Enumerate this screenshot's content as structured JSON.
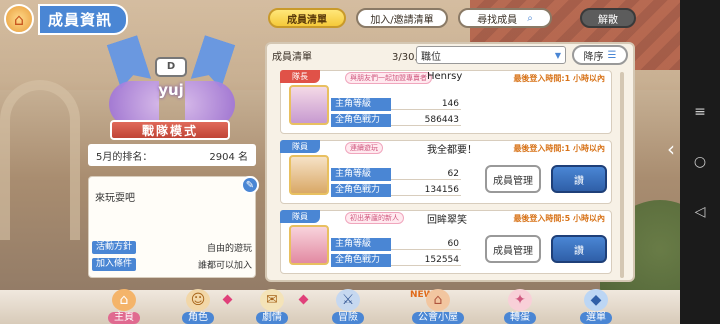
{
  "header": {
    "title": "成員資訊",
    "tabs": [
      {
        "label": "成員清單",
        "active": true
      },
      {
        "label": "加入/邀請清單",
        "active": false
      },
      {
        "label": "尋找成員",
        "active": false
      }
    ],
    "disband_label": "解散"
  },
  "clan": {
    "rank_badge": "D",
    "name": "yuj",
    "mode": "戰隊模式",
    "rank_label": "5月的排名：",
    "rank_value": "2904 名",
    "description": "來玩耍吧",
    "activity_label": "活動方針",
    "activity_value": "自由的遊玩",
    "join_label": "加入條件",
    "join_value": "誰都可以加入"
  },
  "list": {
    "label": "成員清單",
    "count": "3/30人",
    "sort_field": "職位",
    "order_label": "降序",
    "members": [
      {
        "role": "隊長",
        "title": "與朋友們一起加盟專賣者",
        "name": "Henrsy",
        "last_login": "最後登入時間:1 小時以內",
        "level_label": "主角等級",
        "level": "146",
        "power_label": "全角色戰力",
        "power": "586443"
      },
      {
        "role": "隊員",
        "title": "連續遊玩",
        "name": "我全都要！",
        "last_login": "最後登入時間:1 小時以內",
        "level_label": "主角等級",
        "level": "62",
        "power_label": "全角色戰力",
        "power": "134156",
        "manage_label": "成員管理",
        "kick_label": "讚"
      },
      {
        "role": "隊員",
        "title": "初出茅廬的新人",
        "name": "回眸翠笑",
        "last_login": "最後登入時間:5 小時以內",
        "level_label": "主角等級",
        "level": "60",
        "power_label": "全角色戰力",
        "power": "152554",
        "manage_label": "成員管理",
        "kick_label": "讚"
      }
    ]
  },
  "nav": [
    {
      "label": "主頁",
      "icon": "home-icon",
      "active": true
    },
    {
      "label": "角色",
      "icon": "character-icon",
      "active": false
    },
    {
      "label": "劇情",
      "icon": "story-icon",
      "active": false
    },
    {
      "label": "冒險",
      "icon": "adventure-icon",
      "active": false
    },
    {
      "label": "公會小屋",
      "icon": "guild-house-icon",
      "active": false
    },
    {
      "label": "轉蛋",
      "icon": "gacha-icon",
      "active": false
    },
    {
      "label": "選單",
      "icon": "menu-icon",
      "active": false
    }
  ],
  "nav_new": "NEW",
  "colors": {
    "accent": "#4a86d4",
    "leader": "#e05248",
    "login": "#d8741a"
  }
}
